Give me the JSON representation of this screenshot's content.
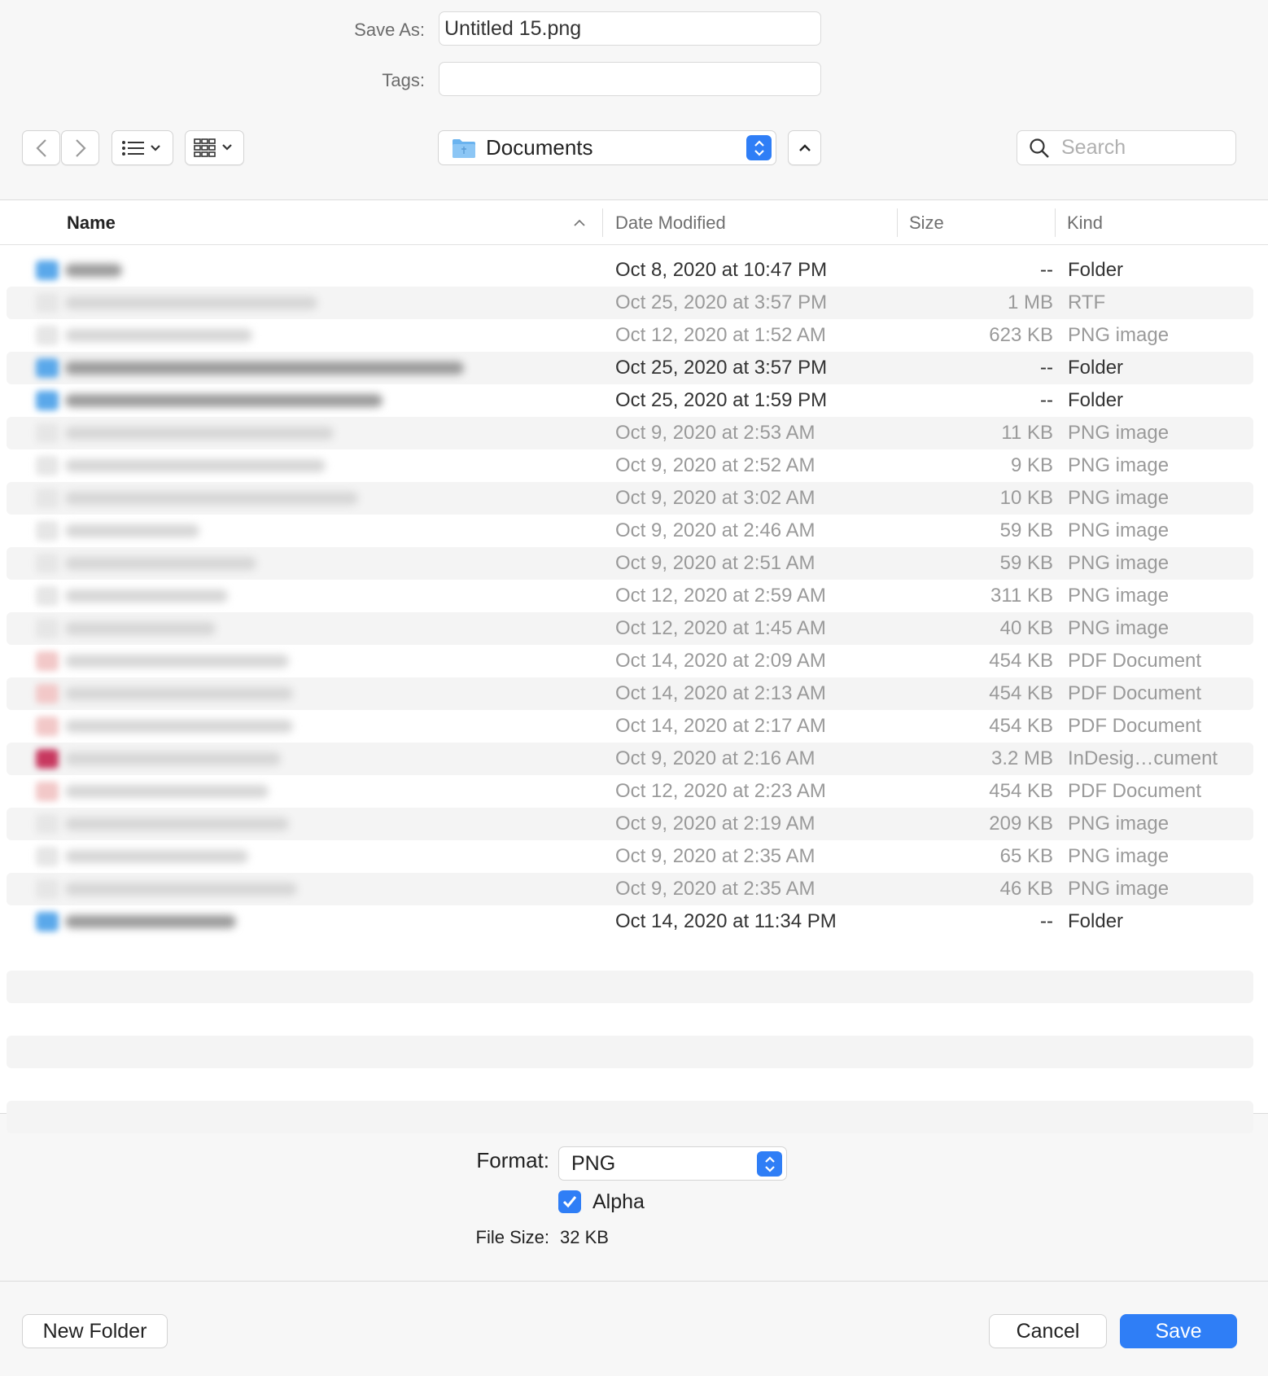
{
  "save_as": {
    "label": "Save As:",
    "value": "Untitled 15.png"
  },
  "tags": {
    "label": "Tags:",
    "value": ""
  },
  "toolbar": {
    "back_icon": "chevron-left-icon",
    "forward_icon": "chevron-right-icon",
    "list_view_icon": "list-icon",
    "grid_view_icon": "grid-icon",
    "location": "Documents",
    "collapse_icon": "chevron-up-icon",
    "search_placeholder": "Search"
  },
  "columns": {
    "name": "Name",
    "date": "Date Modified",
    "size": "Size",
    "kind": "Kind"
  },
  "rows": [
    {
      "date": "Oct 8, 2020 at 10:47 PM",
      "size": "--",
      "kind": "Folder",
      "folder": true
    },
    {
      "date": "Oct 25, 2020 at 3:57 PM",
      "size": "1 MB",
      "kind": "RTF",
      "folder": false
    },
    {
      "date": "Oct 12, 2020 at 1:52 AM",
      "size": "623 KB",
      "kind": "PNG image",
      "folder": false
    },
    {
      "date": "Oct 25, 2020 at 3:57 PM",
      "size": "--",
      "kind": "Folder",
      "folder": true
    },
    {
      "date": "Oct 25, 2020 at 1:59 PM",
      "size": "--",
      "kind": "Folder",
      "folder": true
    },
    {
      "date": "Oct 9, 2020 at 2:53 AM",
      "size": "11 KB",
      "kind": "PNG image",
      "folder": false
    },
    {
      "date": "Oct 9, 2020 at 2:52 AM",
      "size": "9 KB",
      "kind": "PNG image",
      "folder": false
    },
    {
      "date": "Oct 9, 2020 at 3:02 AM",
      "size": "10 KB",
      "kind": "PNG image",
      "folder": false
    },
    {
      "date": "Oct 9, 2020 at 2:46 AM",
      "size": "59 KB",
      "kind": "PNG image",
      "folder": false
    },
    {
      "date": "Oct 9, 2020 at 2:51 AM",
      "size": "59 KB",
      "kind": "PNG image",
      "folder": false
    },
    {
      "date": "Oct 12, 2020 at 2:59 AM",
      "size": "311 KB",
      "kind": "PNG image",
      "folder": false
    },
    {
      "date": "Oct 12, 2020 at 1:45 AM",
      "size": "40 KB",
      "kind": "PNG image",
      "folder": false
    },
    {
      "date": "Oct 14, 2020 at 2:09 AM",
      "size": "454 KB",
      "kind": "PDF Document",
      "folder": false
    },
    {
      "date": "Oct 14, 2020 at 2:13 AM",
      "size": "454 KB",
      "kind": "PDF Document",
      "folder": false
    },
    {
      "date": "Oct 14, 2020 at 2:17 AM",
      "size": "454 KB",
      "kind": "PDF Document",
      "folder": false
    },
    {
      "date": "Oct 9, 2020 at 2:16 AM",
      "size": "3.2 MB",
      "kind": "InDesig…cument",
      "folder": false
    },
    {
      "date": "Oct 12, 2020 at 2:23 AM",
      "size": "454 KB",
      "kind": "PDF Document",
      "folder": false
    },
    {
      "date": "Oct 9, 2020 at 2:19 AM",
      "size": "209 KB",
      "kind": "PNG image",
      "folder": false
    },
    {
      "date": "Oct 9, 2020 at 2:35 AM",
      "size": "65 KB",
      "kind": "PNG image",
      "folder": false
    },
    {
      "date": "Oct 9, 2020 at 2:35 AM",
      "size": "46 KB",
      "kind": "PNG image",
      "folder": false
    },
    {
      "date": "Oct 14, 2020 at 11:34 PM",
      "size": "--",
      "kind": "Folder",
      "folder": true
    }
  ],
  "format": {
    "label": "Format:",
    "value": "PNG"
  },
  "alpha": {
    "label": "Alpha",
    "checked": true
  },
  "file_size": {
    "label": "File Size:",
    "value": "32 KB"
  },
  "buttons": {
    "new_folder": "New Folder",
    "cancel": "Cancel",
    "save": "Save"
  },
  "colors": {
    "accent": "#2f7ef6",
    "folder": "#5aa8ea"
  }
}
